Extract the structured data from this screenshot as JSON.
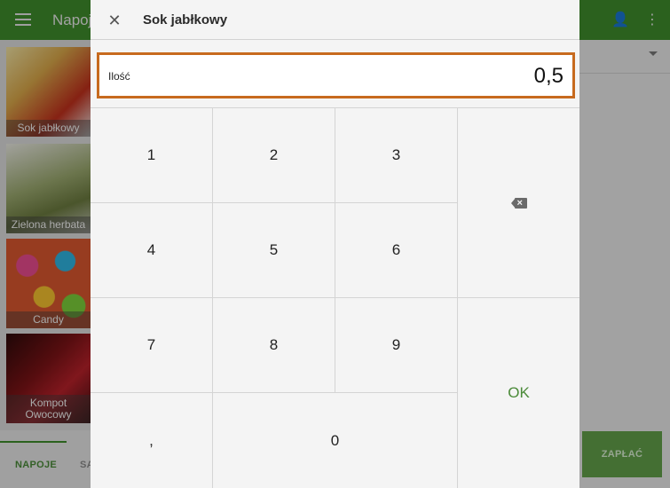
{
  "app": {
    "title": "Napoje"
  },
  "tiles": [
    {
      "label": "Sok jabłkowy"
    },
    {
      "label": "Zielona herbata"
    },
    {
      "label": "Candy"
    },
    {
      "label": "Kompot Owocowy"
    }
  ],
  "bottom_tabs": [
    {
      "label": "NAPOJE"
    },
    {
      "label": "SA"
    }
  ],
  "pay_button": {
    "label": "ZAPŁAĆ"
  },
  "dialog": {
    "title": "Sok jabłkowy",
    "close_icon": "close-icon",
    "quantity": {
      "label": "Ilość",
      "value": "0,5"
    },
    "keys": {
      "k1": "1",
      "k2": "2",
      "k3": "3",
      "k4": "4",
      "k5": "5",
      "k6": "6",
      "k7": "7",
      "k8": "8",
      "k9": "9",
      "comma": ",",
      "k0": "0",
      "ok": "OK"
    }
  },
  "colors": {
    "brand_green": "#3e8b2c",
    "focus_orange": "#c76a1e",
    "ok_green": "#4a8a38"
  }
}
